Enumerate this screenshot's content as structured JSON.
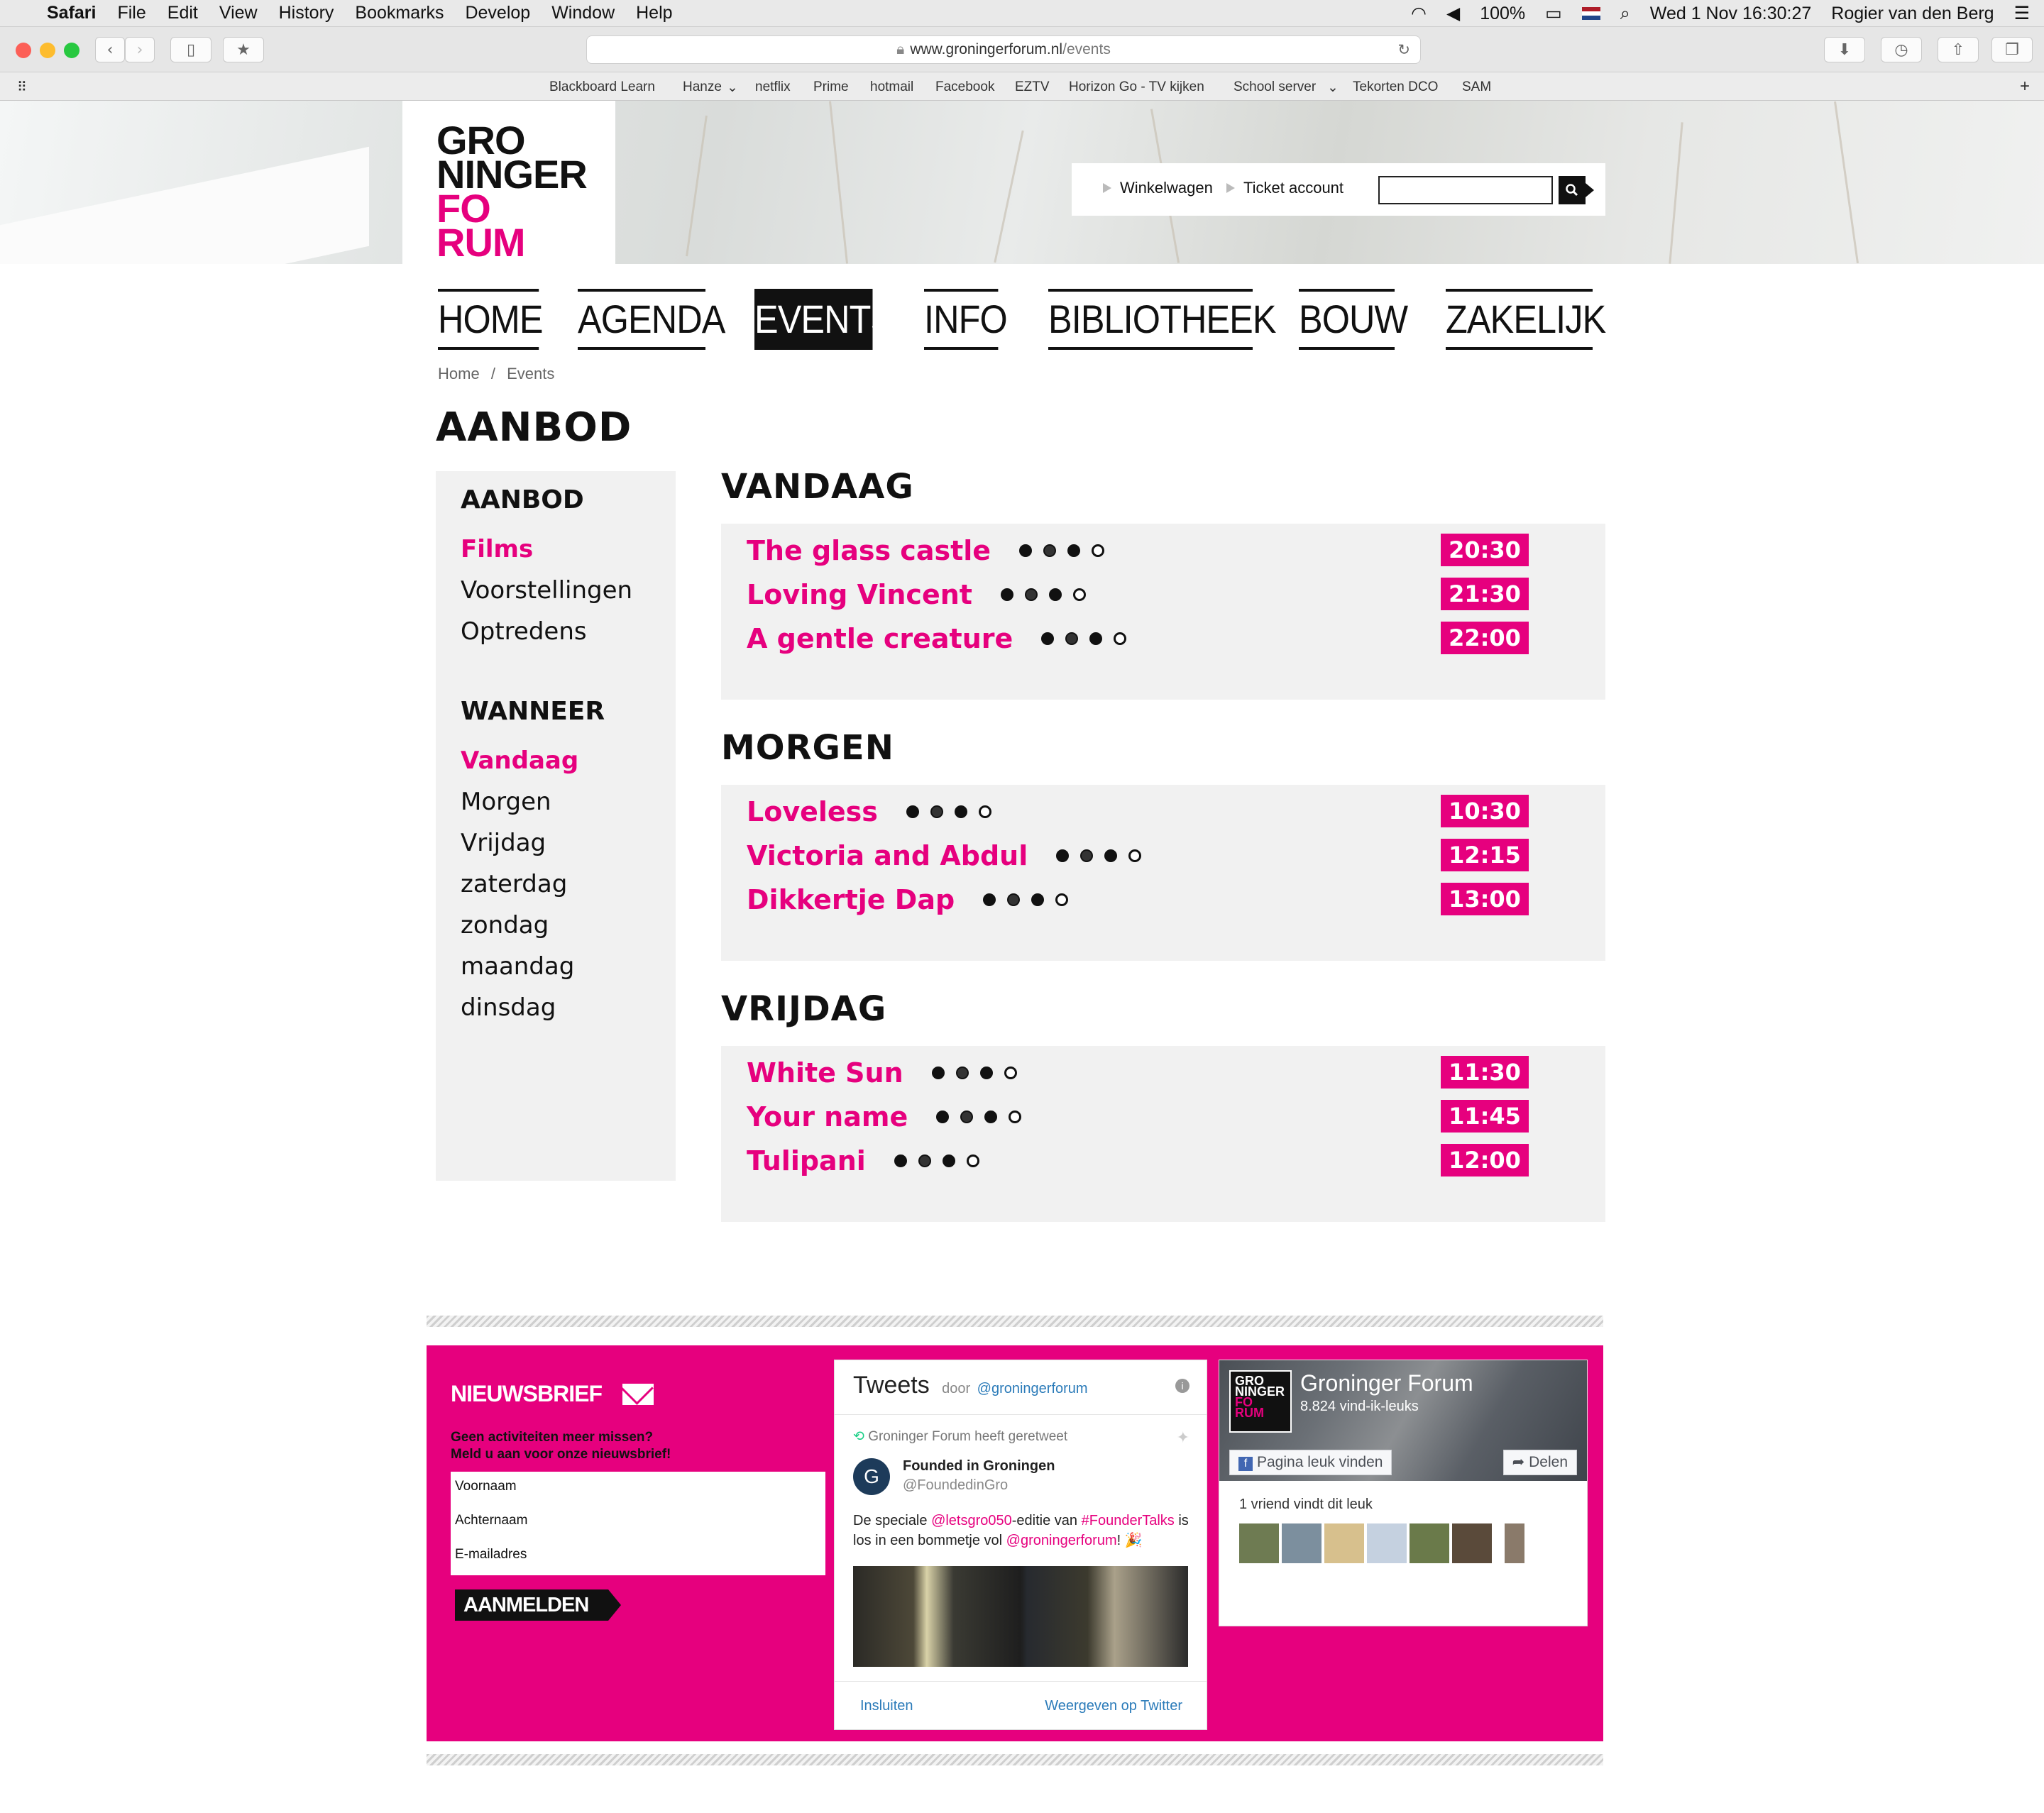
{
  "os_menu": {
    "app": "Safari",
    "items": [
      "File",
      "Edit",
      "View",
      "History",
      "Bookmarks",
      "Develop",
      "Window",
      "Help"
    ],
    "battery": "100%",
    "datetime": "Wed 1 Nov  16:30:27",
    "user": "Rogier van den Berg"
  },
  "browser": {
    "url_domain": "www.groningerforum.nl",
    "url_path": "/events",
    "bookmarks": [
      "Blackboard Learn",
      "Hanze",
      "netflix",
      "Prime",
      "hotmail",
      "Facebook",
      "EZTV",
      "Horizon Go - TV kijken",
      "School server",
      "Tekorten DCO",
      "SAM"
    ]
  },
  "header": {
    "logo_lines": [
      "GRO",
      "NINGER",
      "FO",
      "RUM"
    ],
    "cart_link": "Winkelwagen",
    "account_link": "Ticket account",
    "search_placeholder": ""
  },
  "nav": [
    "HOME",
    "AGENDA",
    "EVENTS",
    "INFO",
    "BIBLIOTHEEK",
    "BOUW",
    "ZAKELIJK"
  ],
  "nav_active": "EVENTS",
  "breadcrumb": {
    "home": "Home",
    "sep": "/",
    "current": "Events"
  },
  "page_title": "AANBOD",
  "sidebar": {
    "aanbod_heading": "AANBOD",
    "aanbod_items": [
      "Films",
      "Voorstellingen",
      "Optredens"
    ],
    "wanneer_heading": "WANNEER",
    "wanneer_items": [
      "Vandaag",
      "Morgen",
      "Vrijdag",
      "zaterdag",
      "zondag",
      "maandag",
      "dinsdag"
    ]
  },
  "days": [
    {
      "heading": "VANDAAG",
      "events": [
        {
          "title": "The glass castle",
          "time": "20:30"
        },
        {
          "title": "Loving Vincent",
          "time": "21:30"
        },
        {
          "title": "A gentle creature",
          "time": "22:00"
        }
      ]
    },
    {
      "heading": "MORGEN",
      "events": [
        {
          "title": "Loveless",
          "time": "10:30"
        },
        {
          "title": "Victoria and Abdul",
          "time": "12:15"
        },
        {
          "title": "Dikkertje Dap",
          "time": "13:00"
        }
      ]
    },
    {
      "heading": "VRIJDAG",
      "events": [
        {
          "title": "White Sun",
          "time": "11:30"
        },
        {
          "title": "Your name",
          "time": "11:45"
        },
        {
          "title": "Tulipani",
          "time": "12:00"
        }
      ]
    }
  ],
  "newsletter": {
    "title": "NIEUWSBRIEF",
    "sub1": "Geen activiteiten meer missen?",
    "sub2": "Meld u aan voor onze nieuwsbrief!",
    "field_first": "Voornaam",
    "field_last": "Achternaam",
    "field_email": "E-mailadres",
    "button": "AANMELDEN"
  },
  "twitter": {
    "title": "Tweets",
    "by": "door",
    "handle": "@groningerforum",
    "retweet": "Groninger Forum heeft geretweet",
    "author": "Founded in Groningen",
    "author_handle": "@FoundedinGro",
    "t1": "De speciale ",
    "t2": "@letsgro050",
    "t3": "-editie van ",
    "t4": "#FounderTalks",
    "t5": "is los in een bommetje vol ",
    "t6": "@groningerforum",
    "t7": "! 🎉",
    "embed": "Insluiten",
    "view": "Weergeven op Twitter"
  },
  "facebook": {
    "page": "Groninger Forum",
    "likes": "8.824 vind-ik-leuks",
    "like_btn": "Pagina leuk vinden",
    "share": "Delen",
    "friends": "1 vriend vindt dit leuk"
  },
  "colors": {
    "accent": "#e6007e",
    "text": "#111111",
    "panel": "#f1f1f1"
  }
}
